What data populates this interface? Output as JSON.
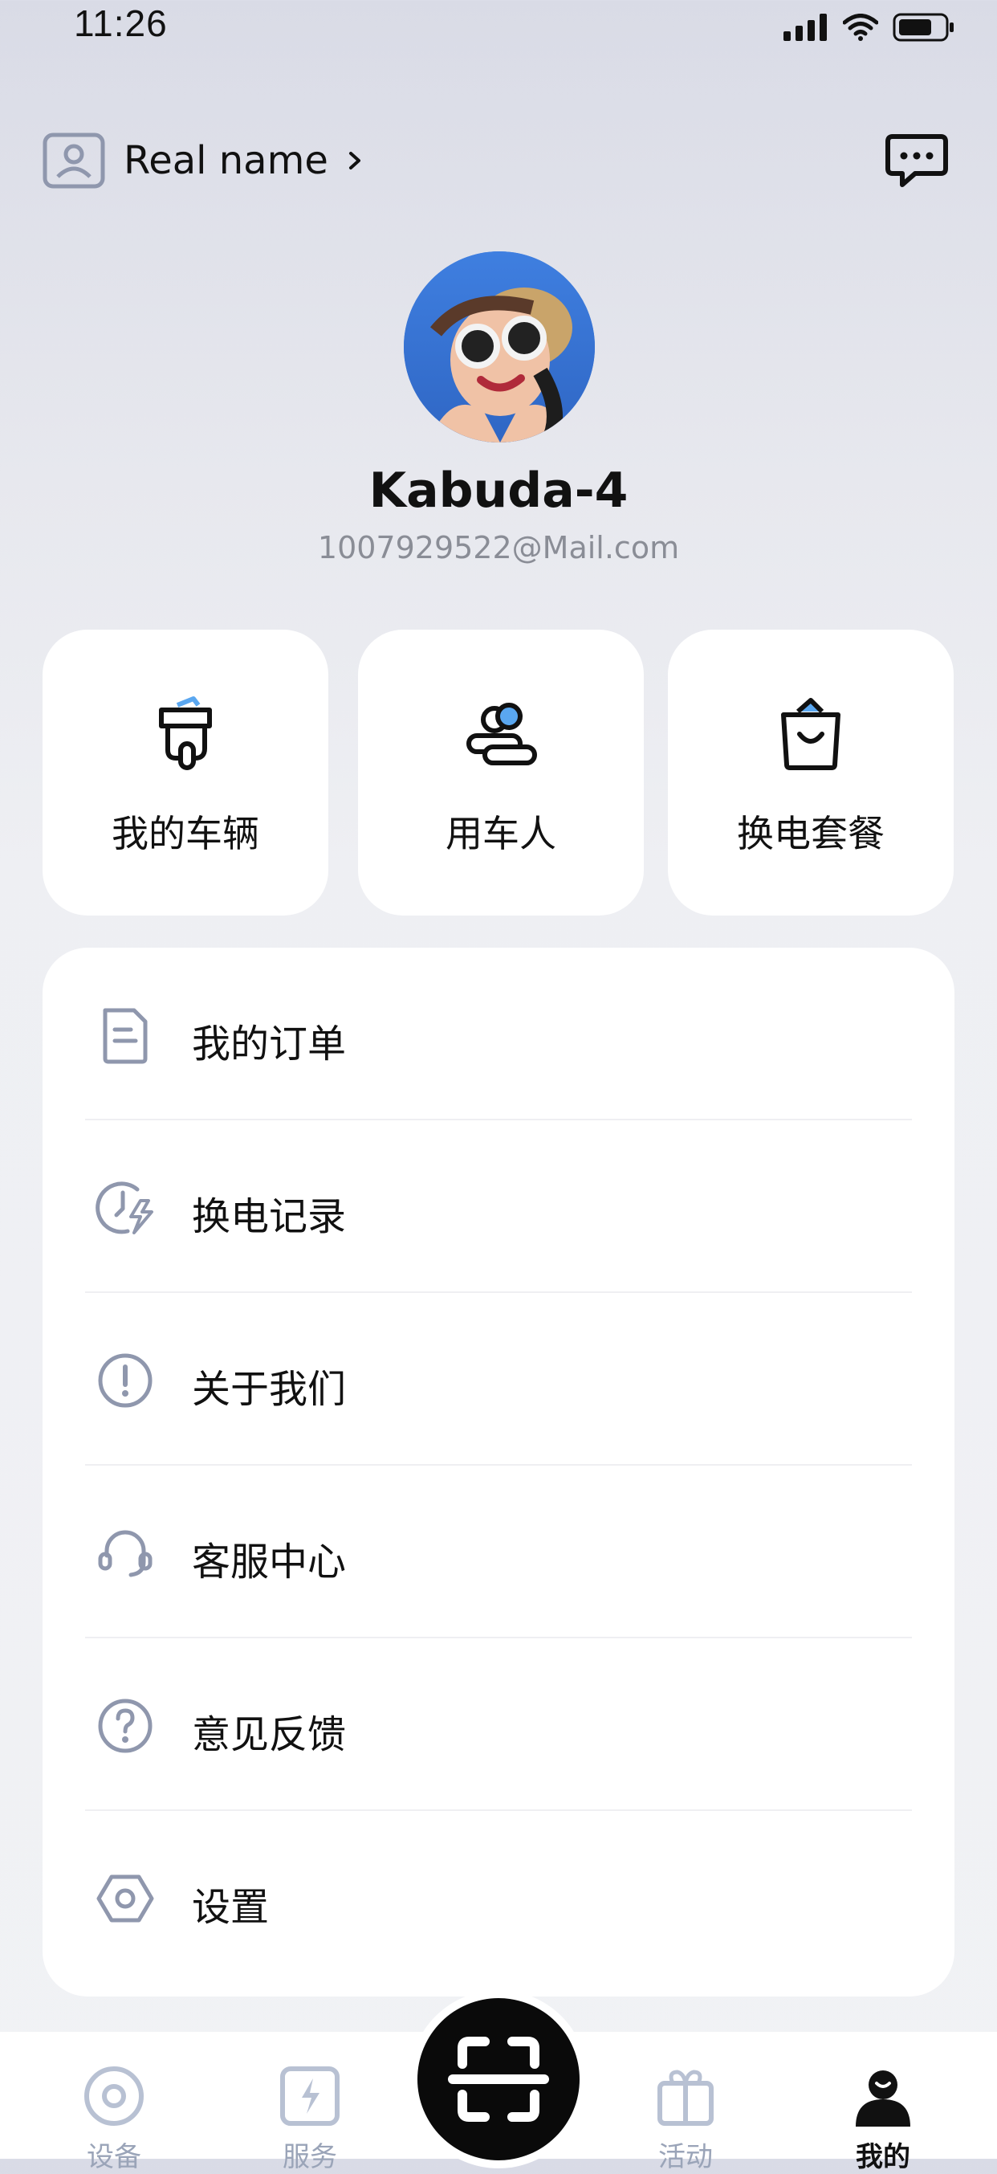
{
  "status_bar": {
    "time": "11:26"
  },
  "header": {
    "realname_label": "Real name"
  },
  "profile": {
    "username": "Kabuda-4",
    "email": "1007929522@Mail.com"
  },
  "quick_actions": [
    {
      "label": "我的车辆",
      "icon": "scooter-icon"
    },
    {
      "label": "用车人",
      "icon": "users-icon"
    },
    {
      "label": "换电套餐",
      "icon": "shopping-bag-icon"
    }
  ],
  "menu": [
    {
      "label": "我的订单",
      "icon": "document-icon"
    },
    {
      "label": "换电记录",
      "icon": "battery-swap-history-icon"
    },
    {
      "label": "关于我们",
      "icon": "info-exclamation-icon"
    },
    {
      "label": "客服中心",
      "icon": "headset-icon"
    },
    {
      "label": "意见反馈",
      "icon": "question-icon"
    },
    {
      "label": "设置",
      "icon": "settings-hexagon-icon"
    }
  ],
  "tabbar": {
    "tabs": [
      {
        "label": "设备",
        "icon": "device-icon",
        "active": false
      },
      {
        "label": "服务",
        "icon": "service-icon",
        "active": false
      },
      {
        "label": "活动",
        "icon": "gift-icon",
        "active": false
      },
      {
        "label": "我的",
        "icon": "profile-icon",
        "active": true
      }
    ],
    "center_button": "scan-icon"
  },
  "colors": {
    "accent_icon": "#8f97ad",
    "text_primary": "#111111",
    "text_secondary": "#8a8d96",
    "inactive_tab": "#9aa4b8",
    "highlight_blue": "#5aa7f0"
  }
}
